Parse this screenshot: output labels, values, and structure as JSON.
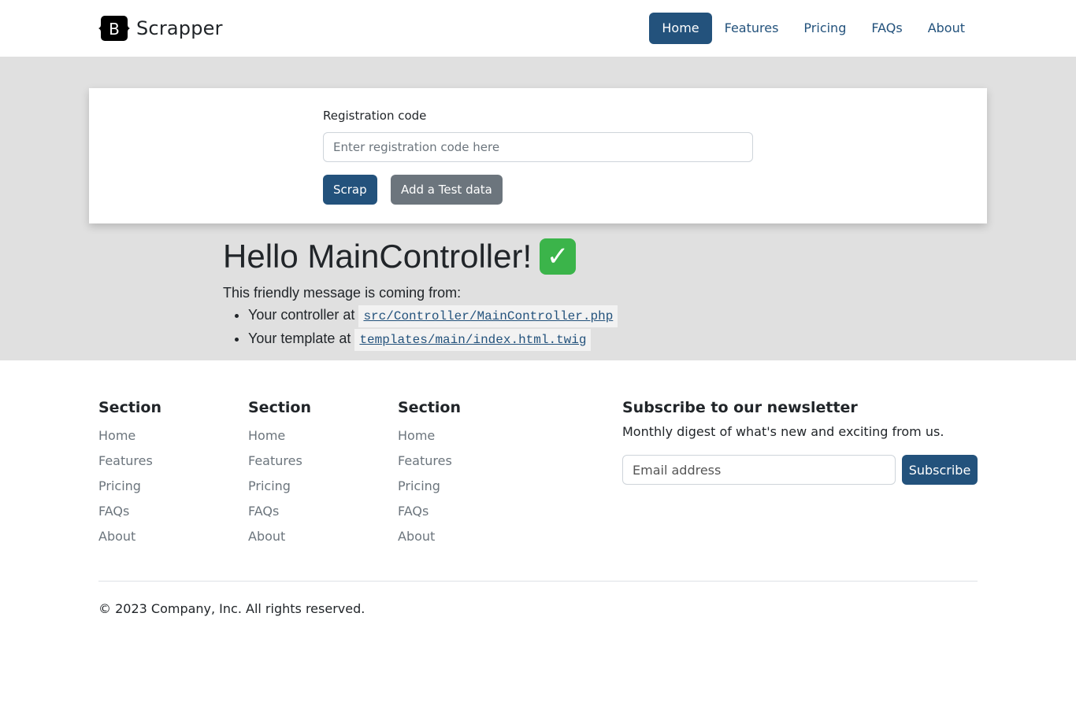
{
  "header": {
    "brand_letter": "B",
    "brand_name": "Scrapper",
    "nav": [
      {
        "label": "Home",
        "active": true
      },
      {
        "label": "Features"
      },
      {
        "label": "Pricing"
      },
      {
        "label": "FAQs"
      },
      {
        "label": "About"
      }
    ]
  },
  "form": {
    "label": "Registration code",
    "placeholder": "Enter registration code here",
    "value": "",
    "scrap_button": "Scrap",
    "test_button": "Add a Test data"
  },
  "hello": {
    "title": "Hello MainController!",
    "check_glyph": "✓",
    "intro": "This friendly message is coming from:",
    "items": [
      {
        "text": "Your controller at",
        "code": "src/Controller/MainController.php"
      },
      {
        "text": "Your template at",
        "code": "templates/main/index.html.twig"
      }
    ]
  },
  "footer": {
    "columns": [
      {
        "title": "Section",
        "links": [
          "Home",
          "Features",
          "Pricing",
          "FAQs",
          "About"
        ]
      },
      {
        "title": "Section",
        "links": [
          "Home",
          "Features",
          "Pricing",
          "FAQs",
          "About"
        ]
      },
      {
        "title": "Section",
        "links": [
          "Home",
          "Features",
          "Pricing",
          "FAQs",
          "About"
        ]
      }
    ],
    "newsletter": {
      "title": "Subscribe to our newsletter",
      "description": "Monthly digest of what's new and exciting from us.",
      "placeholder": "Email address",
      "button": "Subscribe"
    },
    "copyright": "© 2023 Company, Inc. All rights reserved."
  },
  "colors": {
    "primary": "#23527c",
    "secondary": "#6c757d",
    "band": "#e0e0e0",
    "check": "#3bb44a"
  }
}
